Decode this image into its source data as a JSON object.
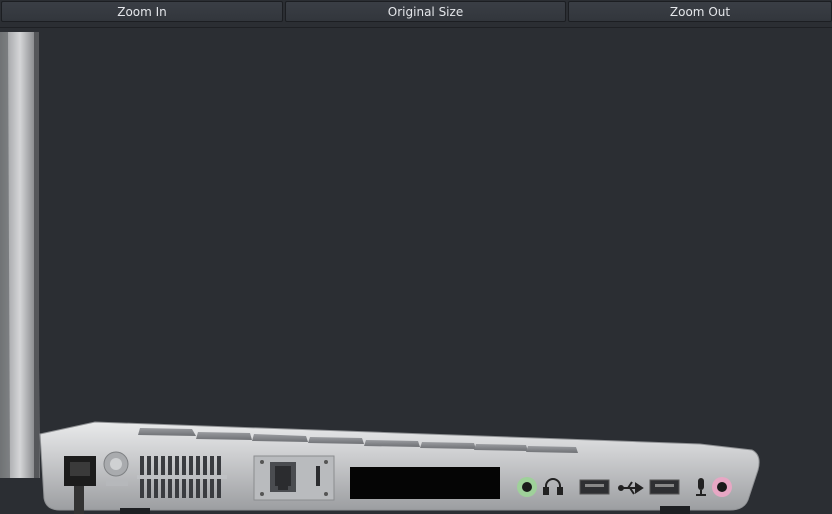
{
  "toolbar": {
    "zoom_in_label": "Zoom In",
    "original_size_label": "Original Size",
    "zoom_out_label": "Zoom Out"
  },
  "viewer": {
    "image_subject": "laptop-side-view",
    "ports": [
      "power-jack",
      "kensington-lock",
      "vent",
      "ethernet-port",
      "expresscard-slot",
      "headphone-jack",
      "usb-port",
      "usb-port",
      "microphone-jack"
    ],
    "icons": [
      "headphone-icon",
      "usb-icon",
      "microphone-icon"
    ]
  },
  "colors": {
    "background": "#2b2e33",
    "chassis": "#c9cacc",
    "jack_headphone": "#9fd19a",
    "jack_microphone": "#e7a7c4"
  }
}
